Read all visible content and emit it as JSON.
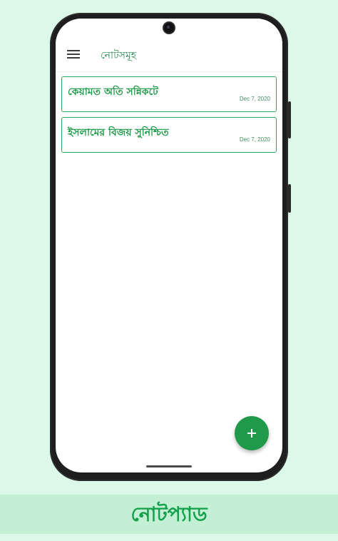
{
  "app_bar": {
    "title": "নোটসমূহ",
    "menu_icon": "hamburger-menu-icon"
  },
  "notes": [
    {
      "title": "কেয়ামত অতি সন্নিকটে",
      "date": "Dec 7, 2020"
    },
    {
      "title": "ইসলামের বিজয় সুনিশ্চিত",
      "date": "Dec 7, 2020"
    }
  ],
  "fab": {
    "icon": "plus-icon"
  },
  "banner": {
    "text": "নোটপ্যাড"
  },
  "colors": {
    "accent": "#1f9a4a",
    "background": "#dcf8e8",
    "banner_background": "#c3efd4"
  }
}
